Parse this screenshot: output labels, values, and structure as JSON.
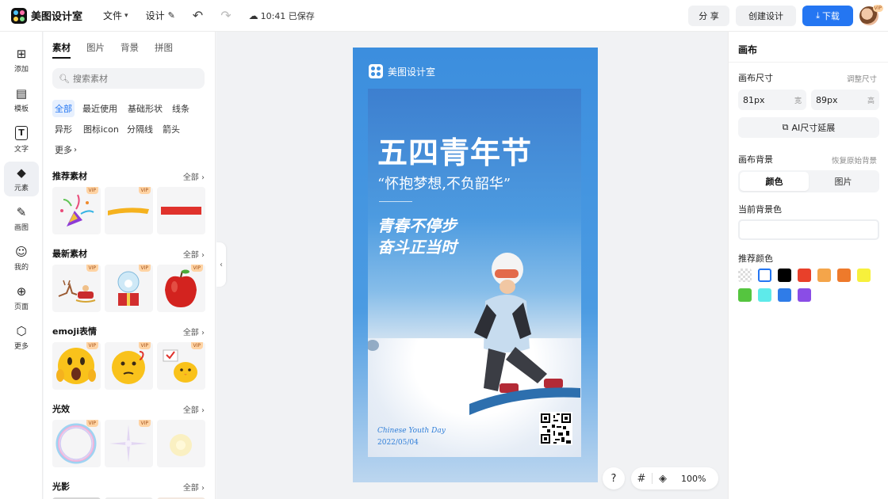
{
  "app": {
    "name": "美图设计室",
    "menu": {
      "file": "文件",
      "design": "设计"
    },
    "save_status": "10:41 已保存",
    "buttons": {
      "share": "分 享",
      "create": "创建设计",
      "download": "下载"
    },
    "avatar_badge": "VIP"
  },
  "rail": [
    {
      "label": "添加",
      "icon": "plus-square-icon"
    },
    {
      "label": "模板",
      "icon": "template-icon"
    },
    {
      "label": "文字",
      "icon": "text-icon"
    },
    {
      "label": "元素",
      "icon": "element-icon",
      "active": true
    },
    {
      "label": "画图",
      "icon": "draw-icon"
    },
    {
      "label": "我的",
      "icon": "user-icon"
    },
    {
      "label": "页面",
      "icon": "page-icon"
    },
    {
      "label": "更多",
      "icon": "more-icon"
    }
  ],
  "panel": {
    "tabs": [
      "素材",
      "图片",
      "背景",
      "拼图"
    ],
    "search_placeholder": "搜索素材",
    "chips": [
      "全部",
      "最近使用",
      "基础形状",
      "线条",
      "异形",
      "图标icon",
      "分隔线",
      "箭头",
      "更多"
    ],
    "all_label": "全部",
    "vip_label": "VIP",
    "sections": [
      {
        "title": "推荐素材",
        "tiles": [
          "party-popper",
          "yellow-brush-stroke",
          "red-bar"
        ]
      },
      {
        "title": "最新素材",
        "tiles": [
          "reindeer-sleigh",
          "snow-globe-gift",
          "red-apple"
        ]
      },
      {
        "title": "emoji表情",
        "tiles": [
          "shocked-emoji",
          "thinking-emoji",
          "chick-emoji"
        ]
      },
      {
        "title": "光效",
        "tiles": [
          "bubble-ring",
          "sparkle-star",
          "soft-glow"
        ]
      },
      {
        "title": "光影",
        "tiles": []
      }
    ]
  },
  "poster": {
    "brand": "美图设计室",
    "title": "五四青年节",
    "subtitle": "“怀抱梦想,不负韶华”",
    "slogan_line1": "青春不停步",
    "slogan_line2": "奋斗正当时",
    "english": "Chinese Youth Day",
    "date": "2022/05/04"
  },
  "zoom": {
    "help": "?",
    "value": "100%"
  },
  "props": {
    "heading": "画布",
    "size_label": "画布尺寸",
    "adjust_size": "调整尺寸",
    "width_value": "81px",
    "width_unit": "宽",
    "height_value": "89px",
    "height_unit": "高",
    "ai_extend": "AI尺寸延展",
    "bg_label": "画布背景",
    "restore_bg": "恢复原始背景",
    "seg_color": "颜色",
    "seg_image": "图片",
    "current_bg": "当前背景色",
    "recommend": "推荐颜色",
    "swatch_colors": [
      "transparent",
      "#ffffff",
      "#000000",
      "#e8402a",
      "#f4a54a",
      "#ee7a2b",
      "#f7f03c",
      "#55c53f",
      "#5eeaea",
      "#2f7ce8",
      "#8a4de6"
    ]
  }
}
